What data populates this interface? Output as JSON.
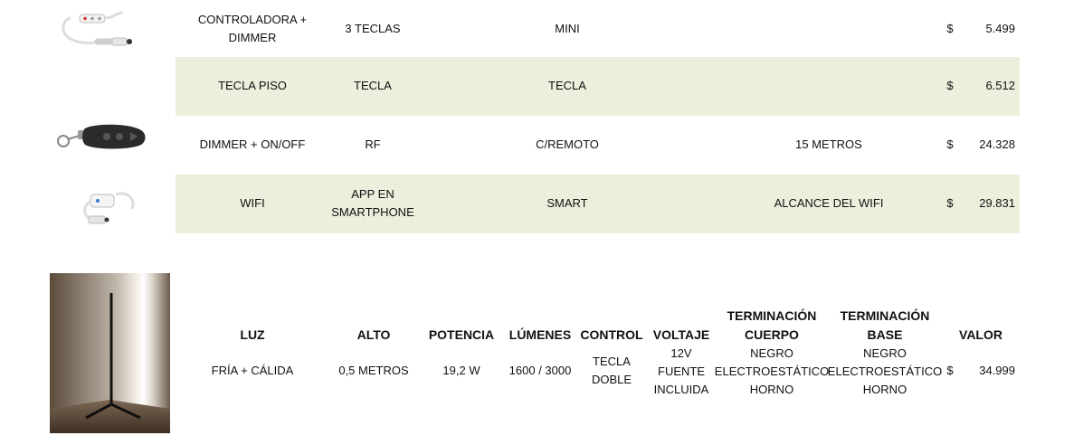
{
  "colors": {
    "band": "#ebf0dd",
    "text": "#111111"
  },
  "options": [
    {
      "name": "CONTROLADORA + DIMMER",
      "type": "3 TECLAS",
      "mode": "MINI",
      "range": "",
      "currency": "$",
      "price": "5.499",
      "image": "led-controller-thumbnail",
      "banded": false
    },
    {
      "name": "TECLA PISO",
      "type": "TECLA",
      "mode": "TECLA",
      "range": "",
      "currency": "$",
      "price": "6.512",
      "image": "",
      "banded": true
    },
    {
      "name": "DIMMER + ON/OFF",
      "type": "RF",
      "mode": "C/REMOTO",
      "range": "15 METROS",
      "currency": "$",
      "price": "24.328",
      "image": "rf-remote-thumbnail",
      "banded": false
    },
    {
      "name": "WIFI",
      "type": "APP EN SMARTPHONE",
      "mode": "SMART",
      "range": "ALCANCE DEL WIFI",
      "currency": "$",
      "price": "29.831",
      "image": "wifi-controller-thumbnail",
      "banded": true
    }
  ],
  "spec": {
    "headers": {
      "luz": "LUZ",
      "alto": "ALTO",
      "potencia": "POTENCIA",
      "lumenes": "LÚMENES",
      "control": "CONTROL",
      "voltaje": "VOLTAJE",
      "term_cuerpo": "TERMINACIÓN CUERPO",
      "term_base": "TERMINACIÓN BASE",
      "valor": "VALOR"
    },
    "values": {
      "luz": "FRÍA + CÁLIDA",
      "alto": "0,5 METROS",
      "potencia": "19,2 W",
      "lumenes": "1600 / 3000",
      "control": "TECLA DOBLE",
      "voltaje": "12V FUENTE INCLUIDA",
      "term_cuerpo": "NEGRO ELECTROESTÁTICO HORNO",
      "term_base": "NEGRO ELECTROESTÁTICO HORNO",
      "currency": "$",
      "valor": "34.999"
    },
    "image": "corner-floor-lamp-photo"
  }
}
